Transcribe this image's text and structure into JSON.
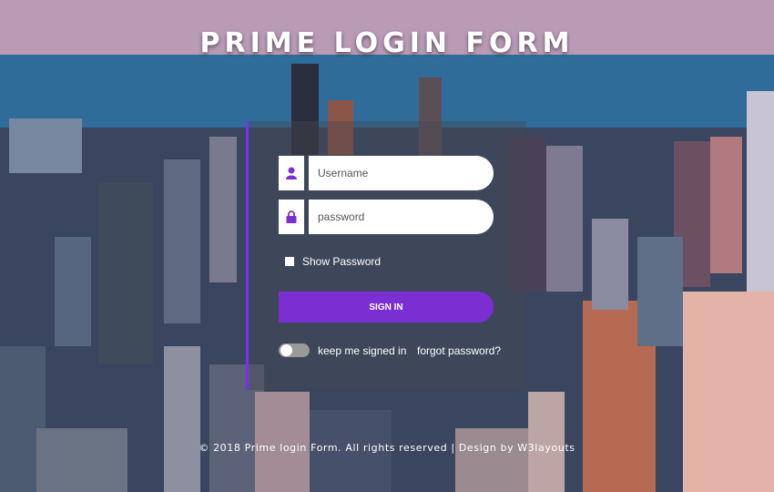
{
  "header": {
    "title": "PRIME LOGIN FORM"
  },
  "form": {
    "username_placeholder": "Username",
    "password_placeholder": "password",
    "show_password_label": "Show Password",
    "sign_in_label": "SIGN IN",
    "keep_signed_in_label": "keep me signed in",
    "forgot_password_label": "forgot password?"
  },
  "icons": {
    "username": "user-icon",
    "password": "lock-icon"
  },
  "colors": {
    "accent": "#7b2fd3",
    "panel_border": "#7b2ff7"
  },
  "footer": {
    "text": "© 2018 Prime login Form. All rights reserved | Design by W3layouts"
  }
}
